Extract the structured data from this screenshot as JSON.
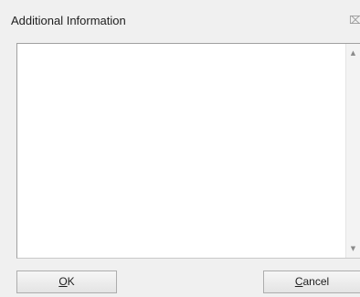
{
  "dialog": {
    "title": "Additional Information",
    "close_glyph": "⌧"
  },
  "textarea": {
    "value": ""
  },
  "scrollbar": {
    "up_glyph": "▲",
    "down_glyph": "▼"
  },
  "buttons": {
    "ok": {
      "mnemonic": "O",
      "rest": "K"
    },
    "cancel": {
      "mnemonic": "C",
      "rest": "ancel"
    }
  },
  "icons": {
    "close": "close-icon",
    "scroll_up": "arrow-up-icon",
    "scroll_down": "arrow-down-icon"
  }
}
